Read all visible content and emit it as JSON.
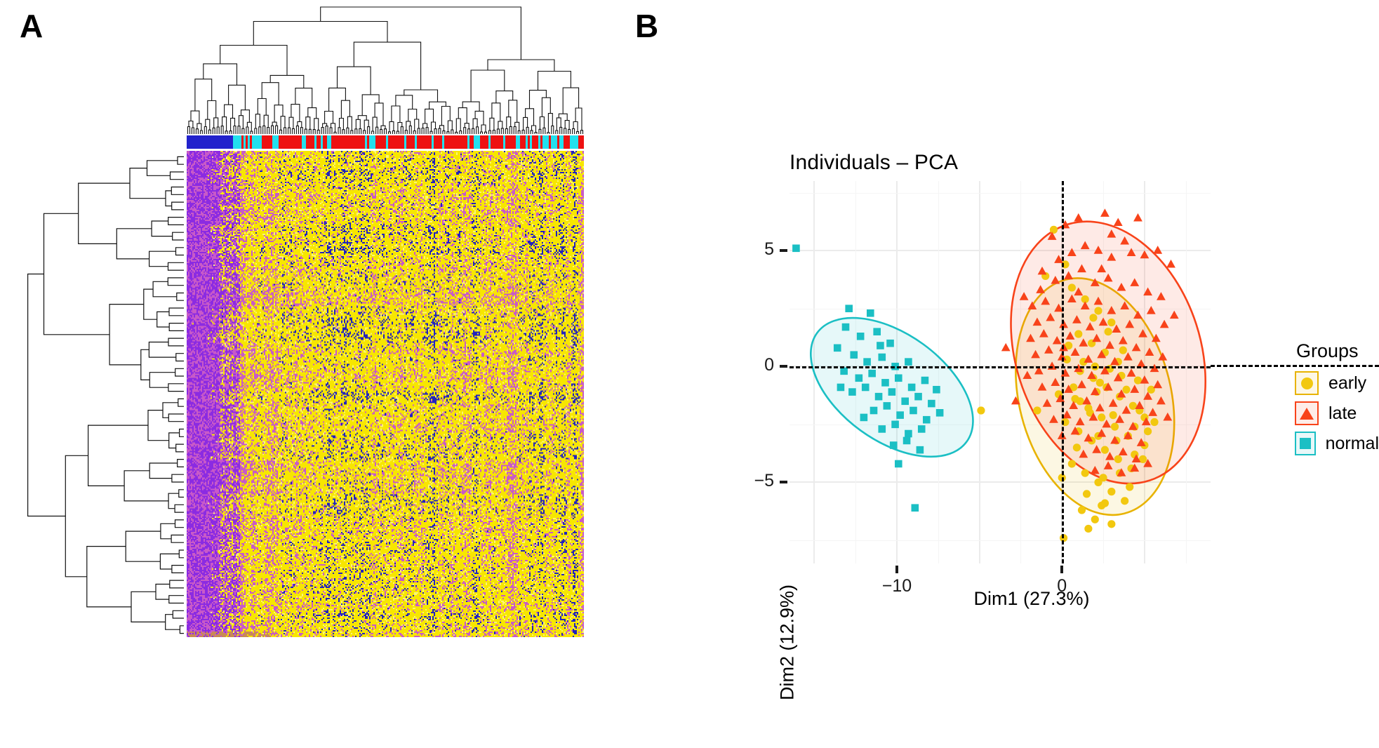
{
  "panels": {
    "a_label": "A",
    "b_label": "B"
  },
  "heatmap": {
    "name": "hierarchical-clustering-heatmap",
    "column_annotation_colors": {
      "blue": "#2222cc",
      "cyan": "#22e0ee",
      "red": "#ee1111"
    },
    "heat_colors": [
      "#f7e600",
      "#c060c0",
      "#8b2be2",
      "#2222bb",
      "#c88a55"
    ],
    "has_column_dendrogram": true,
    "has_row_dendrogram": true
  },
  "chart_data": {
    "type": "scatter",
    "title": "Individuals – PCA",
    "xlabel": "Dim1 (27.3%)",
    "ylabel": "Dim2 (12.9%)",
    "xlim": [
      -16.5,
      9.0
    ],
    "ylim": [
      -8.5,
      8.0
    ],
    "xticks": [
      -10,
      0
    ],
    "xtick_labels": [
      "−10",
      "0"
    ],
    "yticks": [
      -5,
      0,
      5
    ],
    "ytick_labels": [
      "−5",
      "0",
      "5"
    ],
    "grid": true,
    "legend_position": "right",
    "legend_title": "Groups",
    "series": [
      {
        "name": "early",
        "marker": "circle",
        "color": "#E8B300",
        "fill": "#F2C80F",
        "ellipse": {
          "cx": 2.0,
          "cy": -1.3,
          "rx": 4.6,
          "ry": 5.2,
          "angle": -14
        },
        "points": [
          [
            -0.5,
            5.9
          ],
          [
            -1.5,
            -1.9
          ],
          [
            0.6,
            3.4
          ],
          [
            1.4,
            2.9
          ],
          [
            2.2,
            2.4
          ],
          [
            3.0,
            1.9
          ],
          [
            1.0,
            1.4
          ],
          [
            1.8,
            1.0
          ],
          [
            2.6,
            0.6
          ],
          [
            3.4,
            0.2
          ],
          [
            0.3,
            0.3
          ],
          [
            1.1,
            -0.2
          ],
          [
            1.9,
            -0.5
          ],
          [
            2.7,
            -0.9
          ],
          [
            3.5,
            -1.3
          ],
          [
            4.3,
            -1.7
          ],
          [
            0.8,
            -1.4
          ],
          [
            1.6,
            -1.8
          ],
          [
            2.4,
            -2.2
          ],
          [
            3.2,
            -2.6
          ],
          [
            4.0,
            -3.0
          ],
          [
            0.2,
            -2.4
          ],
          [
            1.0,
            -2.8
          ],
          [
            1.8,
            -3.2
          ],
          [
            2.6,
            -3.6
          ],
          [
            3.4,
            -4.0
          ],
          [
            4.2,
            -4.4
          ],
          [
            5.0,
            -2.2
          ],
          [
            0.6,
            -4.2
          ],
          [
            1.4,
            -4.6
          ],
          [
            2.2,
            -5.0
          ],
          [
            3.0,
            -5.4
          ],
          [
            3.8,
            -5.8
          ],
          [
            1.2,
            -6.2
          ],
          [
            2.0,
            -6.6
          ],
          [
            0.1,
            -7.4
          ],
          [
            4.6,
            -0.6
          ],
          [
            5.4,
            -1.0
          ],
          [
            5.0,
            -3.4
          ],
          [
            4.4,
            -2.6
          ],
          [
            2.9,
            -0.1
          ],
          [
            3.7,
            0.7
          ],
          [
            1.3,
            0.2
          ],
          [
            2.1,
            -1.1
          ],
          [
            0.9,
            -3.5
          ],
          [
            1.7,
            -2.0
          ],
          [
            2.5,
            -4.8
          ],
          [
            3.3,
            -3.2
          ],
          [
            4.1,
            -5.2
          ],
          [
            -0.2,
            -1.2
          ],
          [
            0.4,
            0.9
          ],
          [
            2.8,
            1.5
          ],
          [
            3.6,
            -0.4
          ],
          [
            4.9,
            -4.0
          ],
          [
            1.5,
            -5.5
          ],
          [
            2.3,
            -0.7
          ],
          [
            3.1,
            -2.1
          ],
          [
            5.2,
            -2.8
          ],
          [
            0.7,
            -0.9
          ],
          [
            1.9,
            2.1
          ],
          [
            4.7,
            -1.9
          ],
          [
            2.2,
            -3.0
          ],
          [
            3.9,
            -1.0
          ],
          [
            0.0,
            -4.8
          ],
          [
            2.6,
            -5.9
          ],
          [
            4.4,
            -3.8
          ],
          [
            1.1,
            -1.5
          ],
          [
            3.5,
            -4.6
          ],
          [
            5.6,
            -2.4
          ],
          [
            2.0,
            0.0
          ],
          [
            -4.9,
            -1.9
          ],
          [
            -1.0,
            3.9
          ],
          [
            0.2,
            4.4
          ],
          [
            2.4,
            -6.0
          ],
          [
            3.0,
            -6.8
          ],
          [
            1.6,
            -7.0
          ]
        ]
      },
      {
        "name": "late",
        "marker": "triangle",
        "color": "#F8431A",
        "fill": "#F8431A",
        "ellipse": {
          "cx": 2.8,
          "cy": 0.6,
          "rx": 5.6,
          "ry": 5.8,
          "angle": -18
        },
        "points": [
          [
            -2.3,
            3.0
          ],
          [
            -0.6,
            5.6
          ],
          [
            0.2,
            6.1
          ],
          [
            1.0,
            6.4
          ],
          [
            2.6,
            6.6
          ],
          [
            3.4,
            6.2
          ],
          [
            4.6,
            6.4
          ],
          [
            -0.2,
            4.6
          ],
          [
            0.6,
            4.9
          ],
          [
            1.4,
            5.2
          ],
          [
            2.2,
            5.0
          ],
          [
            3.0,
            4.7
          ],
          [
            3.8,
            5.4
          ],
          [
            5.0,
            4.8
          ],
          [
            5.8,
            5.0
          ],
          [
            6.6,
            4.4
          ],
          [
            -1.2,
            4.1
          ],
          [
            -0.4,
            3.7
          ],
          [
            0.4,
            3.9
          ],
          [
            1.2,
            4.2
          ],
          [
            2.0,
            3.6
          ],
          [
            2.8,
            3.8
          ],
          [
            3.6,
            3.4
          ],
          [
            4.4,
            3.6
          ],
          [
            5.2,
            3.2
          ],
          [
            6.0,
            3.0
          ],
          [
            -1.8,
            2.6
          ],
          [
            -1.0,
            2.8
          ],
          [
            -0.2,
            2.5
          ],
          [
            0.6,
            2.9
          ],
          [
            1.4,
            2.6
          ],
          [
            2.2,
            2.8
          ],
          [
            3.0,
            2.4
          ],
          [
            3.8,
            2.6
          ],
          [
            4.6,
            2.2
          ],
          [
            5.4,
            2.4
          ],
          [
            6.2,
            1.8
          ],
          [
            -1.5,
            1.9
          ],
          [
            -0.7,
            2.1
          ],
          [
            0.1,
            1.8
          ],
          [
            0.9,
            2.0
          ],
          [
            1.7,
            1.7
          ],
          [
            2.5,
            1.9
          ],
          [
            3.3,
            1.6
          ],
          [
            4.1,
            1.8
          ],
          [
            4.9,
            1.4
          ],
          [
            5.7,
            1.2
          ],
          [
            -1.9,
            1.2
          ],
          [
            -1.1,
            1.4
          ],
          [
            -0.3,
            1.1
          ],
          [
            0.5,
            1.3
          ],
          [
            1.3,
            1.0
          ],
          [
            2.1,
            1.2
          ],
          [
            2.9,
            0.9
          ],
          [
            3.7,
            1.1
          ],
          [
            4.5,
            0.8
          ],
          [
            5.3,
            0.6
          ],
          [
            6.1,
            0.4
          ],
          [
            -1.6,
            0.5
          ],
          [
            -0.8,
            0.7
          ],
          [
            0.0,
            0.4
          ],
          [
            0.8,
            0.6
          ],
          [
            1.6,
            0.3
          ],
          [
            2.4,
            0.5
          ],
          [
            3.2,
            0.2
          ],
          [
            4.0,
            0.4
          ],
          [
            4.8,
            0.1
          ],
          [
            5.6,
            -0.1
          ],
          [
            -1.4,
            -0.2
          ],
          [
            -0.6,
            0.0
          ],
          [
            0.2,
            -0.3
          ],
          [
            1.0,
            -0.1
          ],
          [
            1.8,
            -0.4
          ],
          [
            2.6,
            -0.2
          ],
          [
            3.4,
            -0.5
          ],
          [
            4.2,
            -0.3
          ],
          [
            5.0,
            -0.6
          ],
          [
            5.8,
            -0.8
          ],
          [
            -1.2,
            -0.9
          ],
          [
            -0.4,
            -0.7
          ],
          [
            0.4,
            -1.0
          ],
          [
            1.2,
            -0.8
          ],
          [
            2.0,
            -1.1
          ],
          [
            2.8,
            -0.9
          ],
          [
            3.6,
            -1.2
          ],
          [
            4.4,
            -1.0
          ],
          [
            5.2,
            -1.3
          ],
          [
            6.0,
            -1.5
          ],
          [
            -0.9,
            -1.6
          ],
          [
            -0.1,
            -1.4
          ],
          [
            0.7,
            -1.7
          ],
          [
            1.5,
            -1.5
          ],
          [
            2.3,
            -1.8
          ],
          [
            3.1,
            -1.6
          ],
          [
            3.9,
            -1.9
          ],
          [
            4.7,
            -1.7
          ],
          [
            5.5,
            -2.0
          ],
          [
            -0.5,
            -2.3
          ],
          [
            0.3,
            -2.1
          ],
          [
            1.1,
            -2.4
          ],
          [
            1.9,
            -2.2
          ],
          [
            2.7,
            -2.5
          ],
          [
            3.5,
            -2.3
          ],
          [
            4.3,
            -2.6
          ],
          [
            5.1,
            -2.4
          ],
          [
            0.0,
            -3.0
          ],
          [
            0.8,
            -2.8
          ],
          [
            1.6,
            -3.1
          ],
          [
            2.4,
            -2.9
          ],
          [
            3.2,
            -3.2
          ],
          [
            4.0,
            -3.0
          ],
          [
            4.8,
            -3.3
          ],
          [
            1.3,
            -3.8
          ],
          [
            2.1,
            -3.6
          ],
          [
            2.9,
            -3.9
          ],
          [
            3.7,
            -3.7
          ],
          [
            4.5,
            -4.0
          ],
          [
            2.0,
            -4.5
          ],
          [
            2.8,
            -4.3
          ],
          [
            3.6,
            -4.6
          ],
          [
            4.4,
            -4.4
          ],
          [
            5.2,
            -4.2
          ],
          [
            -2.8,
            -1.5
          ],
          [
            -3.4,
            0.8
          ],
          [
            -2.1,
            -0.4
          ],
          [
            6.8,
            2.2
          ],
          [
            6.4,
            -2.2
          ],
          [
            1.0,
            3.2
          ],
          [
            2.4,
            4.2
          ],
          [
            4.2,
            4.9
          ],
          [
            -1.3,
            3.3
          ],
          [
            0.1,
            0.8
          ],
          [
            3.0,
            5.7
          ]
        ]
      },
      {
        "name": "normal",
        "marker": "square",
        "color": "#1BBFC4",
        "fill": "#1BBFC4",
        "ellipse": {
          "cx": -10.3,
          "cy": -0.9,
          "rx": 5.6,
          "ry": 2.3,
          "angle": 36
        },
        "points": [
          [
            -16.1,
            5.1
          ],
          [
            -12.9,
            2.5
          ],
          [
            -11.6,
            2.3
          ],
          [
            -13.1,
            1.7
          ],
          [
            -12.2,
            1.3
          ],
          [
            -11.2,
            1.5
          ],
          [
            -10.4,
            1.0
          ],
          [
            -13.6,
            0.8
          ],
          [
            -12.6,
            0.5
          ],
          [
            -11.8,
            0.2
          ],
          [
            -10.9,
            0.4
          ],
          [
            -10.1,
            0.0
          ],
          [
            -9.3,
            0.2
          ],
          [
            -13.2,
            -0.2
          ],
          [
            -12.3,
            -0.5
          ],
          [
            -11.5,
            -0.3
          ],
          [
            -10.7,
            -0.7
          ],
          [
            -9.9,
            -0.5
          ],
          [
            -9.1,
            -0.9
          ],
          [
            -8.3,
            -0.6
          ],
          [
            -12.7,
            -1.1
          ],
          [
            -11.9,
            -0.9
          ],
          [
            -11.1,
            -1.3
          ],
          [
            -10.3,
            -1.1
          ],
          [
            -9.5,
            -1.5
          ],
          [
            -8.7,
            -1.3
          ],
          [
            -7.9,
            -1.6
          ],
          [
            -11.4,
            -1.9
          ],
          [
            -10.6,
            -1.7
          ],
          [
            -9.8,
            -2.1
          ],
          [
            -9.0,
            -1.9
          ],
          [
            -8.2,
            -2.3
          ],
          [
            -7.4,
            -2.0
          ],
          [
            -10.9,
            -2.7
          ],
          [
            -10.1,
            -2.5
          ],
          [
            -9.3,
            -2.9
          ],
          [
            -8.5,
            -2.7
          ],
          [
            -10.2,
            -3.4
          ],
          [
            -9.4,
            -3.2
          ],
          [
            -8.6,
            -3.6
          ],
          [
            -9.9,
            -4.2
          ],
          [
            -8.9,
            -6.1
          ],
          [
            -12.0,
            -2.2
          ],
          [
            -13.4,
            -0.9
          ],
          [
            -11.0,
            0.9
          ],
          [
            -7.6,
            -1.0
          ]
        ]
      }
    ]
  }
}
